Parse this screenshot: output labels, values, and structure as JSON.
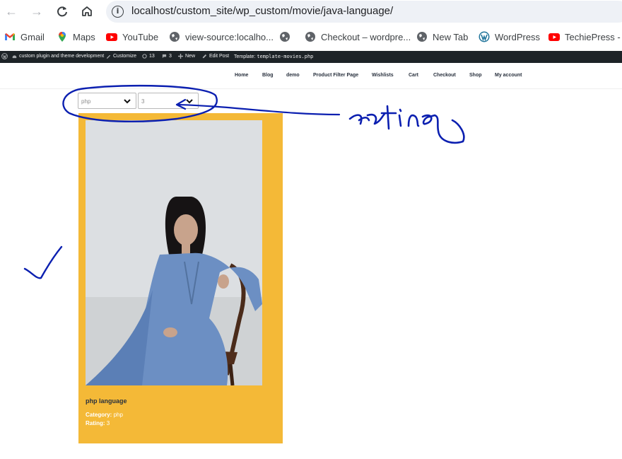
{
  "browser": {
    "url": "localhost/custom_site/wp_custom/movie/java-language/",
    "bookmarks": [
      {
        "label": "Gmail",
        "icon": "gmail-icon"
      },
      {
        "label": "Maps",
        "icon": "maps-icon"
      },
      {
        "label": "YouTube",
        "icon": "youtube-icon"
      },
      {
        "label": "view-source:localho...",
        "icon": "globe-icon"
      },
      {
        "label": "",
        "icon": "globe-icon"
      },
      {
        "label": "Checkout – wordpre...",
        "icon": "globe-icon"
      },
      {
        "label": "New Tab",
        "icon": "globe-icon"
      },
      {
        "label": "WordPress",
        "icon": "wordpress-icon"
      },
      {
        "label": "TechiePress - Yo",
        "icon": "youtube-icon"
      }
    ]
  },
  "adminbar": {
    "site_name": "custom plugin and theme development",
    "customize": "Customize",
    "updates_count": "13",
    "comments_count": "3",
    "new": "New",
    "edit_post": "Edit Post",
    "template_label": "Template:",
    "template_file": "template-movies.php"
  },
  "site_nav": [
    "Home",
    "Blog",
    "demo",
    "Product Filter Page",
    "Wishlists",
    "Cart",
    "Checkout",
    "Shop",
    "My account"
  ],
  "filters": {
    "category_value": "php",
    "rating_value": "3"
  },
  "annotation": {
    "handwritten_word": "rating"
  },
  "movie": {
    "title": "php language",
    "category_label": "Category:",
    "category_value": "php",
    "rating_label": "Rating:",
    "rating_value": "3"
  },
  "colors": {
    "card_background": "#f4b937",
    "adminbar_background": "#1d2327",
    "annotation_ink": "#0b1fb0"
  }
}
